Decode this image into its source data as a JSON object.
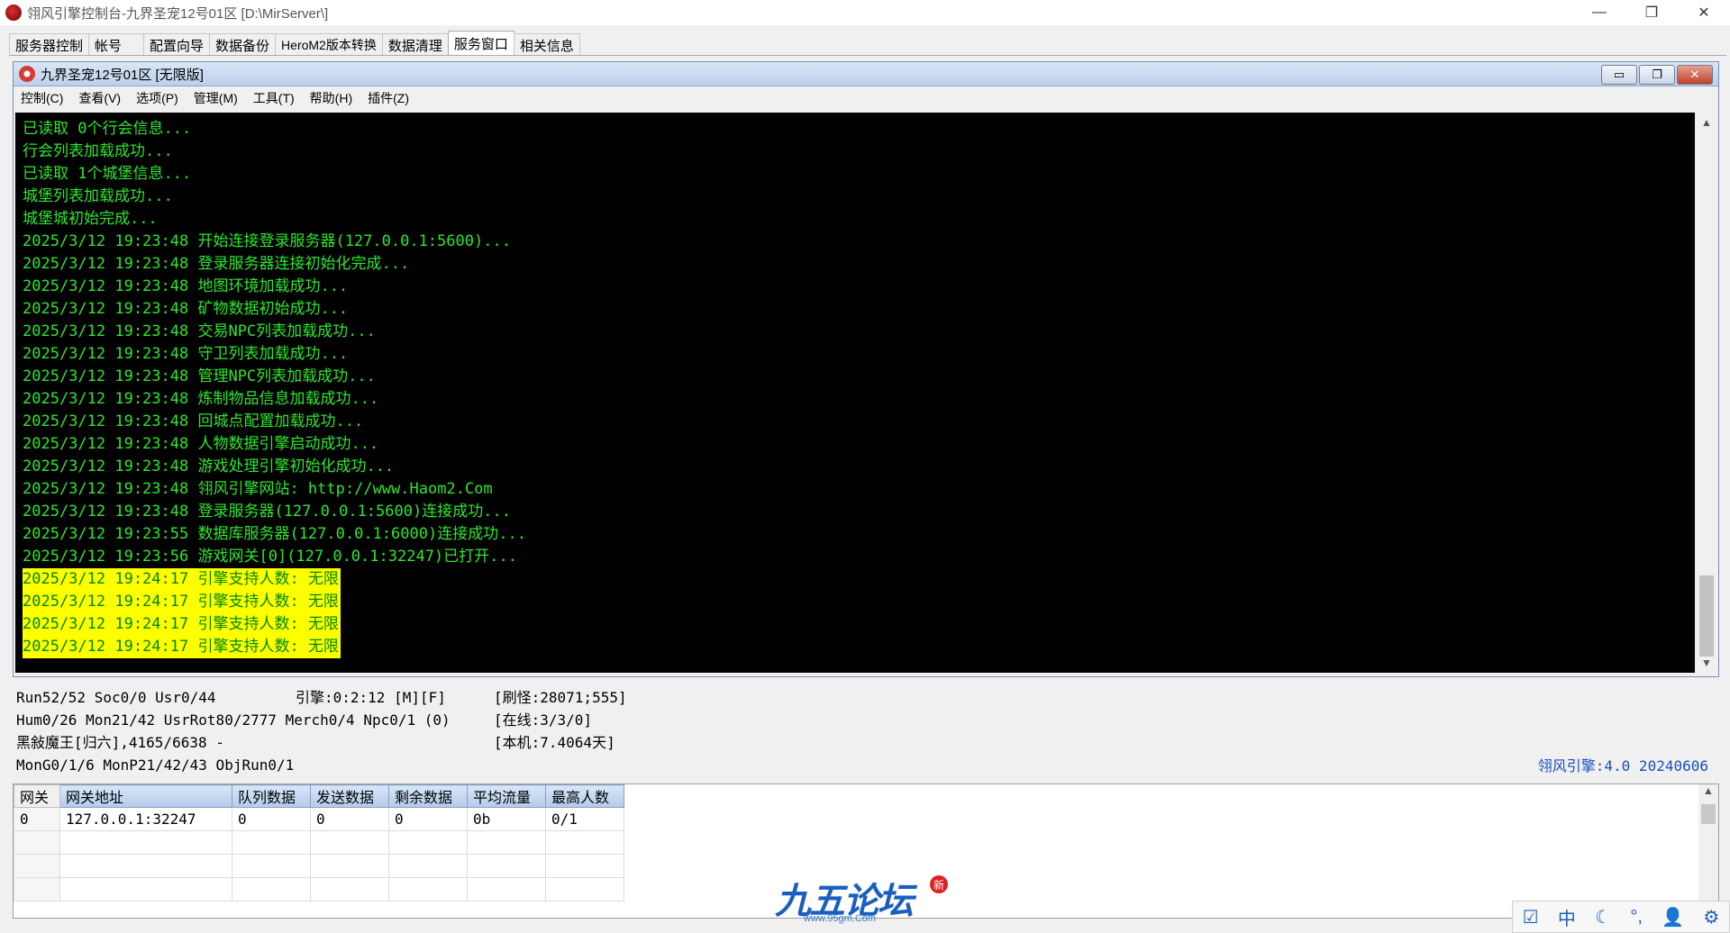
{
  "window": {
    "title": "翎风引擎控制台-九界圣宠12号01区 [D:\\MirServer\\]",
    "minimize": "—",
    "restore": "❐",
    "close": "✕"
  },
  "tabs": [
    {
      "label": "服务器控制"
    },
    {
      "label": "帐号"
    },
    {
      "label": "配置向导"
    },
    {
      "label": "数据备份"
    },
    {
      "label": "HeroM2版本转换"
    },
    {
      "label": "数据清理"
    },
    {
      "label": "服务窗口"
    },
    {
      "label": "相关信息"
    }
  ],
  "inner": {
    "title": "九界圣宠12号01区 [无限版]",
    "menu": [
      "控制(C)",
      "查看(V)",
      "选项(P)",
      "管理(M)",
      "工具(T)",
      "帮助(H)",
      "插件(Z)"
    ]
  },
  "console": {
    "lines": [
      {
        "text": "已读取 0个行会信息...",
        "hl": false
      },
      {
        "text": "行会列表加载成功...",
        "hl": false
      },
      {
        "text": "已读取 1个城堡信息...",
        "hl": false
      },
      {
        "text": "城堡列表加载成功...",
        "hl": false
      },
      {
        "text": "城堡城初始完成...",
        "hl": false
      },
      {
        "text": "2025/3/12 19:23:48 开始连接登录服务器(127.0.0.1:5600)...",
        "hl": false
      },
      {
        "text": "2025/3/12 19:23:48 登录服务器连接初始化完成...",
        "hl": false
      },
      {
        "text": "2025/3/12 19:23:48 地图环境加载成功...",
        "hl": false
      },
      {
        "text": "2025/3/12 19:23:48 矿物数据初始成功...",
        "hl": false
      },
      {
        "text": "2025/3/12 19:23:48 交易NPC列表加载成功...",
        "hl": false
      },
      {
        "text": "2025/3/12 19:23:48 守卫列表加载成功...",
        "hl": false
      },
      {
        "text": "2025/3/12 19:23:48 管理NPC列表加载成功...",
        "hl": false
      },
      {
        "text": "2025/3/12 19:23:48 炼制物品信息加载成功...",
        "hl": false
      },
      {
        "text": "2025/3/12 19:23:48 回城点配置加载成功...",
        "hl": false
      },
      {
        "text": "2025/3/12 19:23:48 人物数据引擎启动成功...",
        "hl": false
      },
      {
        "text": "2025/3/12 19:23:48 游戏处理引擎初始化成功...",
        "hl": false
      },
      {
        "text": "2025/3/12 19:23:48 翎风引擎网站: http://www.Haom2.Com",
        "hl": false
      },
      {
        "text": "2025/3/12 19:23:48 登录服务器(127.0.0.1:5600)连接成功...",
        "hl": false
      },
      {
        "text": "2025/3/12 19:23:55 数据库服务器(127.0.0.1:6000)连接成功...",
        "hl": false
      },
      {
        "text": "2025/3/12 19:23:56 游戏网关[0](127.0.0.1:32247)已打开...",
        "hl": false
      },
      {
        "text": "2025/3/12 19:24:17 引擎支持人数: 无限",
        "hl": true
      },
      {
        "text": "2025/3/12 19:24:17 引擎支持人数: 无限",
        "hl": true
      },
      {
        "text": "2025/3/12 19:24:17 引擎支持人数: 无限",
        "hl": true
      },
      {
        "text": "2025/3/12 19:24:17 引擎支持人数: 无限",
        "hl": true
      }
    ]
  },
  "status": {
    "row1_left": "Run52/52 Soc0/0 Usr0/44",
    "row1_mid": "引擎:0:2:12 [M][F]",
    "row1_right": "[刷怪:28071;555]",
    "row2_left": "Hum0/26 Mon21/42 UsrRot80/2777 Merch0/4 Npc0/1 (0)",
    "row2_right": "[在线:3/3/0]",
    "row3_left": "黑敍魔王[归六],4165/6638 -",
    "row3_right": "[本机:7.4064天]",
    "row4_left": "MonG0/1/6 MonP21/42/43 ObjRun0/1",
    "engine_version": "翎风引擎:4.0 20240606"
  },
  "gateway": {
    "headers": [
      "网关",
      "网关地址",
      "队列数据",
      "发送数据",
      "剩余数据",
      "平均流量",
      "最高人数"
    ],
    "rows": [
      [
        "0",
        "127.0.0.1:32247",
        "0",
        "0",
        "0",
        "0b",
        "0/1"
      ]
    ]
  },
  "logo": {
    "text": "九五论坛",
    "url": "www.95gm.Com",
    "badge": "新"
  },
  "ime": [
    "☑",
    "中",
    "☾",
    "°,",
    "👤",
    "⚙"
  ]
}
